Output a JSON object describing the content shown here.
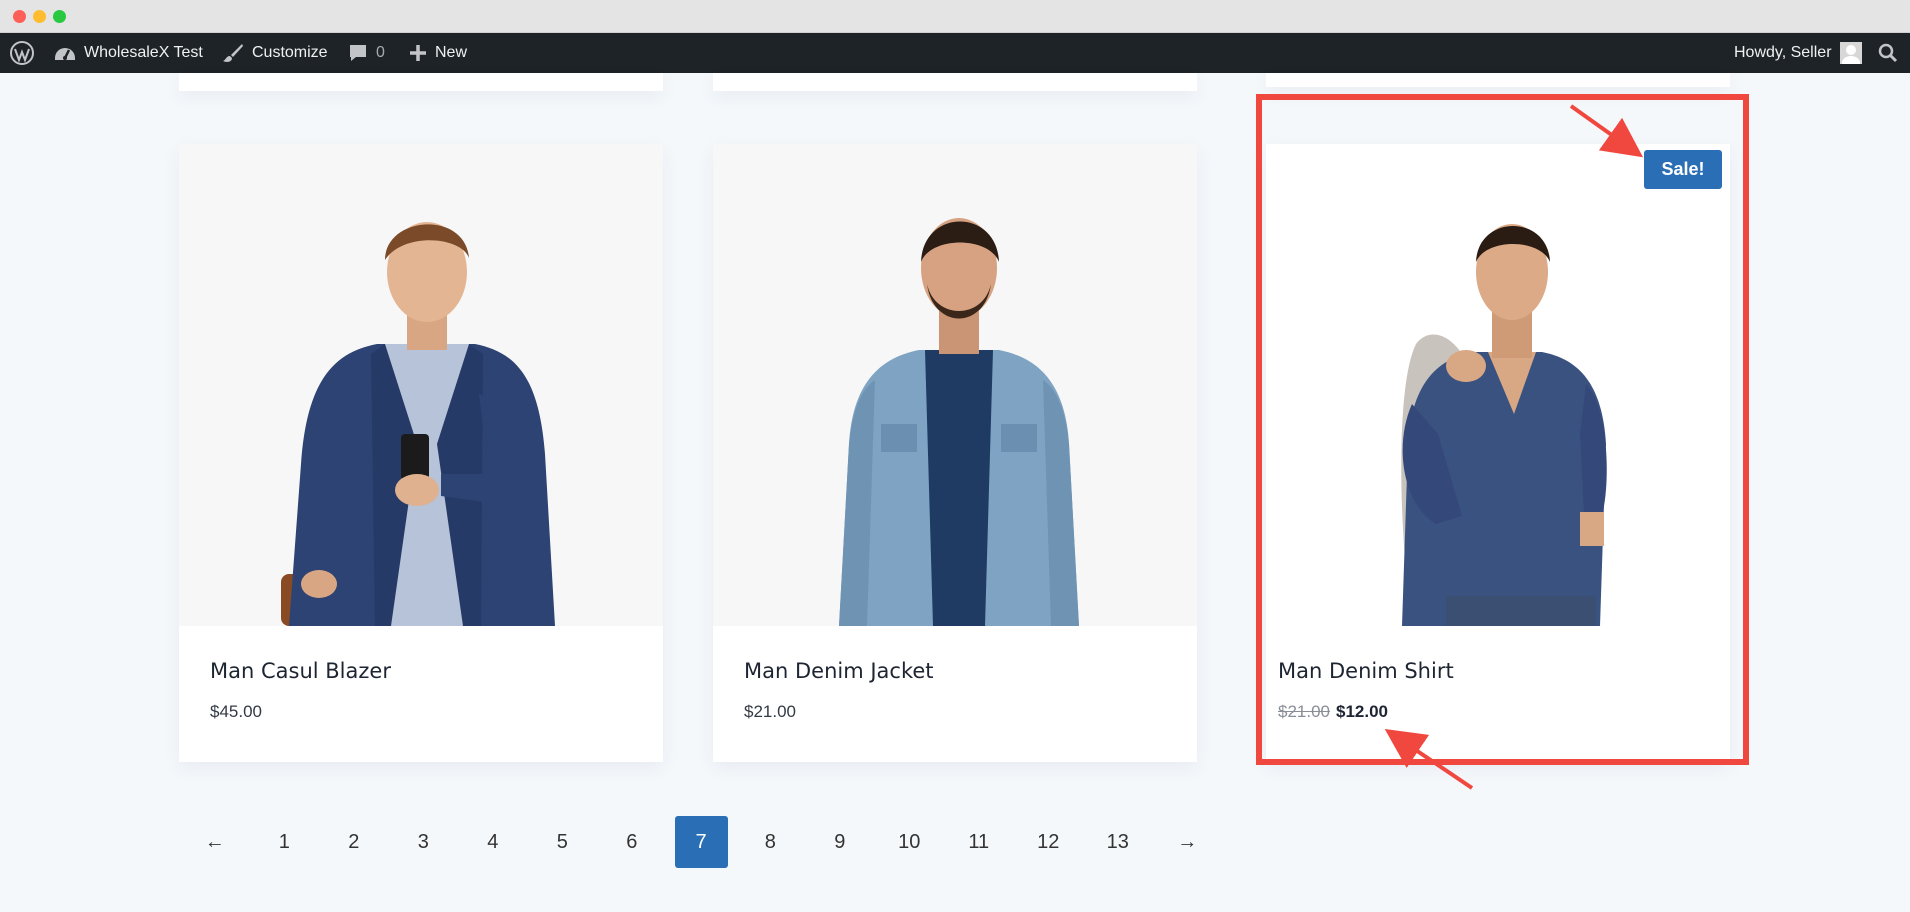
{
  "admin_bar": {
    "site_name": "WholesaleX Test",
    "customize_label": "Customize",
    "comments_count": "0",
    "new_label": "New",
    "greeting": "Howdy, Seller"
  },
  "products": [
    {
      "name": "Man Casul Blazer",
      "price": "$45.00",
      "image": "man-blazer-photo"
    },
    {
      "name": "Man Denim Jacket",
      "price": "$21.00",
      "image": "man-jacket-photo"
    },
    {
      "name": "Man Denim Shirt",
      "regular_price": "$21.00",
      "sale_price": "$12.00",
      "badge": "Sale!",
      "image": "man-shirt-photo"
    }
  ],
  "pagination": {
    "prev": "←",
    "pages": [
      "1",
      "2",
      "3",
      "4",
      "5",
      "6",
      "7",
      "8",
      "9",
      "10",
      "11",
      "12",
      "13"
    ],
    "current": "7",
    "next": "→"
  },
  "colors": {
    "accent": "#2a6fb5",
    "highlight": "#f0473f",
    "admin_bar": "#1d2327"
  }
}
